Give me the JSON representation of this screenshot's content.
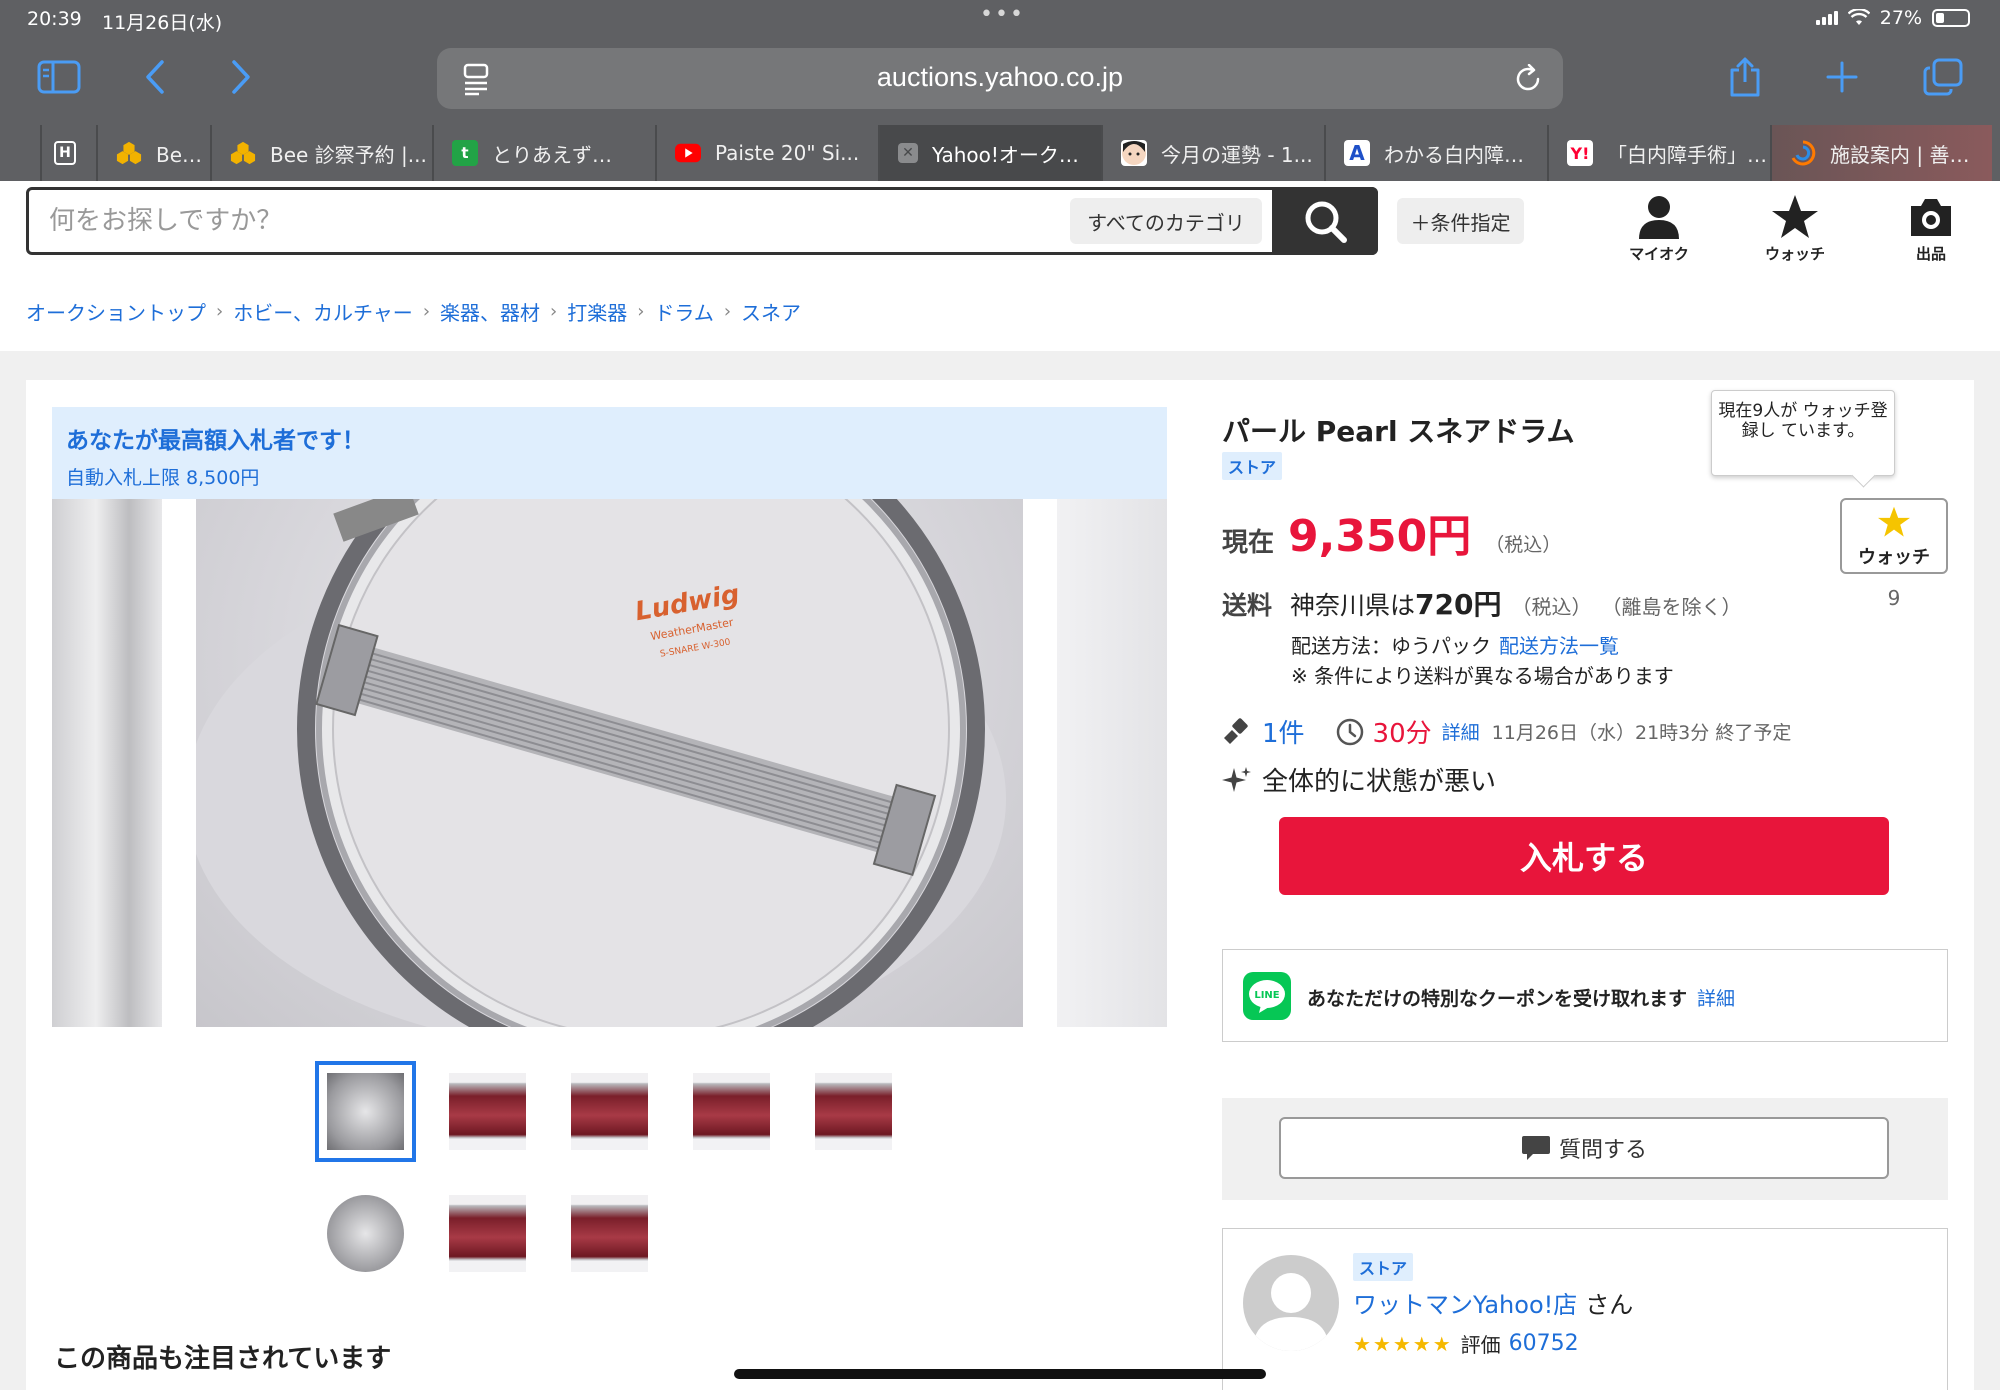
{
  "status": {
    "time": "20:39",
    "date": "11月26日(水)",
    "battery": "27%"
  },
  "browser": {
    "url": "auctions.yahoo.co.jp",
    "tabs": [
      {
        "label": "Bee 診",
        "icon": "bee-icon"
      },
      {
        "label": "Bee 診察予約 |...",
        "icon": "bee-icon"
      },
      {
        "label": "とりあえず…",
        "icon": "green-t-icon"
      },
      {
        "label": "Paiste 20\" Si...",
        "icon": "youtube-icon"
      },
      {
        "label": "Yahoo!オーク…",
        "icon": "close-icon"
      },
      {
        "label": "今月の運勢 - 1...",
        "icon": "face-icon"
      },
      {
        "label": "わかる白内障…",
        "icon": "a-icon"
      },
      {
        "label": "「白内障手術」…",
        "icon": "yahoo-y-icon"
      },
      {
        "label": "施設案内 | 善…",
        "icon": "swirl-icon"
      }
    ],
    "first_tab_letter": "H"
  },
  "header": {
    "search_placeholder": "何をお探しですか？",
    "category": "すべてのカテゴリ",
    "condition_button": "＋条件指定",
    "links": {
      "myauc": "マイオク",
      "watch": "ウォッチ",
      "sell": "出品"
    }
  },
  "breadcrumb": [
    "オークショントップ",
    "ホビー、カルチャー",
    "楽器、器材",
    "打楽器",
    "ドラム",
    "スネア"
  ],
  "banner": {
    "title": "あなたが最高額入札者です！",
    "limit": "自動入札上限 8,500円"
  },
  "item": {
    "title": "パール Pearl スネアドラム",
    "store_badge": "ストア",
    "price_label": "現在",
    "price": "9,350円",
    "tax": "（税込）",
    "shipping_label": "送料",
    "shipping_region": "神奈川県は",
    "shipping_amount": "720円",
    "shipping_tax": "（税込）",
    "shipping_except": "（離島を除く）",
    "shipping_method": "配送方法：ゆうパック",
    "shipping_method_link": "配送方法一覧",
    "shipping_note": "※ 条件により送料が異なる場合があります",
    "bids": "1件",
    "time_left": "30分",
    "detail_link": "詳細",
    "end_time": "11月26日（水）21時3分 終了予定",
    "condition": "全体的に状態が悪い",
    "bid_button": "入札する"
  },
  "watch": {
    "tooltip": "現在9人が ウォッチ登録し ています。",
    "button": "ウォッチ",
    "count": "9"
  },
  "line_coupon": {
    "text": "あなただけの特別なクーポンを受け取れます",
    "link": "詳細",
    "icon_label": "LINE"
  },
  "question_button": "質問する",
  "seller": {
    "badge": "ストア",
    "name": "ワットマンYahoo!店",
    "suffix": "さん",
    "rating_label": "評価",
    "rating": "60752"
  },
  "also_viewed_title": "この商品も注目されています",
  "drum_head_text": {
    "brand": "Ludwig",
    "line1": "WeatherMaster",
    "line2": "S-SNARE  W-300"
  }
}
